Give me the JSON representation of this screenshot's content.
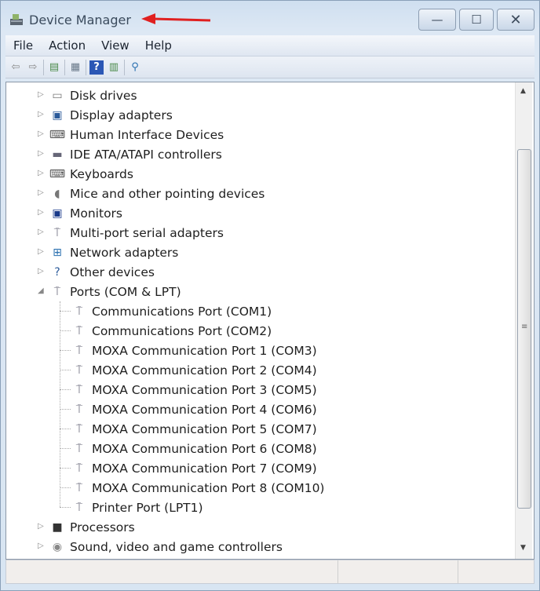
{
  "window": {
    "title": "Device Manager",
    "minimize": "—",
    "maximize": "☐",
    "close": "✕"
  },
  "menu": [
    "File",
    "Action",
    "View",
    "Help"
  ],
  "toolbar": [
    "back-icon",
    "forward-icon",
    "show-hide-console-tree-icon",
    "properties-icon",
    "help-icon",
    "action-pane-icon",
    "scan-hardware-icon"
  ],
  "tree": [
    {
      "label": "Disk drives",
      "icon": "disk-drive-icon",
      "level": 0,
      "expanded": false
    },
    {
      "label": "Display adapters",
      "icon": "display-adapter-icon",
      "level": 0,
      "expanded": false
    },
    {
      "label": "Human Interface Devices",
      "icon": "hid-icon",
      "level": 0,
      "expanded": false
    },
    {
      "label": "IDE ATA/ATAPI controllers",
      "icon": "ide-controller-icon",
      "level": 0,
      "expanded": false
    },
    {
      "label": "Keyboards",
      "icon": "keyboard-icon",
      "level": 0,
      "expanded": false
    },
    {
      "label": "Mice and other pointing devices",
      "icon": "mouse-icon",
      "level": 0,
      "expanded": false
    },
    {
      "label": "Monitors",
      "icon": "monitor-icon",
      "level": 0,
      "expanded": false
    },
    {
      "label": "Multi-port serial adapters",
      "icon": "port-icon",
      "level": 0,
      "expanded": false
    },
    {
      "label": "Network adapters",
      "icon": "network-icon",
      "level": 0,
      "expanded": false
    },
    {
      "label": "Other devices",
      "icon": "unknown-device-icon",
      "level": 0,
      "expanded": false
    },
    {
      "label": "Ports (COM & LPT)",
      "icon": "port-icon",
      "level": 0,
      "expanded": true
    },
    {
      "label": "Communications Port (COM1)",
      "icon": "port-icon",
      "level": 1
    },
    {
      "label": "Communications Port (COM2)",
      "icon": "port-icon",
      "level": 1
    },
    {
      "label": "MOXA Communication Port 1 (COM3)",
      "icon": "port-icon",
      "level": 1
    },
    {
      "label": "MOXA Communication Port 2 (COM4)",
      "icon": "port-icon",
      "level": 1
    },
    {
      "label": "MOXA Communication Port 3 (COM5)",
      "icon": "port-icon",
      "level": 1
    },
    {
      "label": "MOXA Communication Port 4 (COM6)",
      "icon": "port-icon",
      "level": 1
    },
    {
      "label": "MOXA Communication Port 5 (COM7)",
      "icon": "port-icon",
      "level": 1
    },
    {
      "label": "MOXA Communication Port 6 (COM8)",
      "icon": "port-icon",
      "level": 1
    },
    {
      "label": "MOXA Communication Port 7 (COM9)",
      "icon": "port-icon",
      "level": 1
    },
    {
      "label": "MOXA Communication Port 8 (COM10)",
      "icon": "port-icon",
      "level": 1
    },
    {
      "label": "Printer Port (LPT1)",
      "icon": "port-icon",
      "level": 1
    },
    {
      "label": "Processors",
      "icon": "processor-icon",
      "level": 0,
      "expanded": false
    },
    {
      "label": "Sound, video and game controllers",
      "icon": "sound-icon",
      "level": 0,
      "expanded": false
    }
  ],
  "annotation_color": "#e02020"
}
